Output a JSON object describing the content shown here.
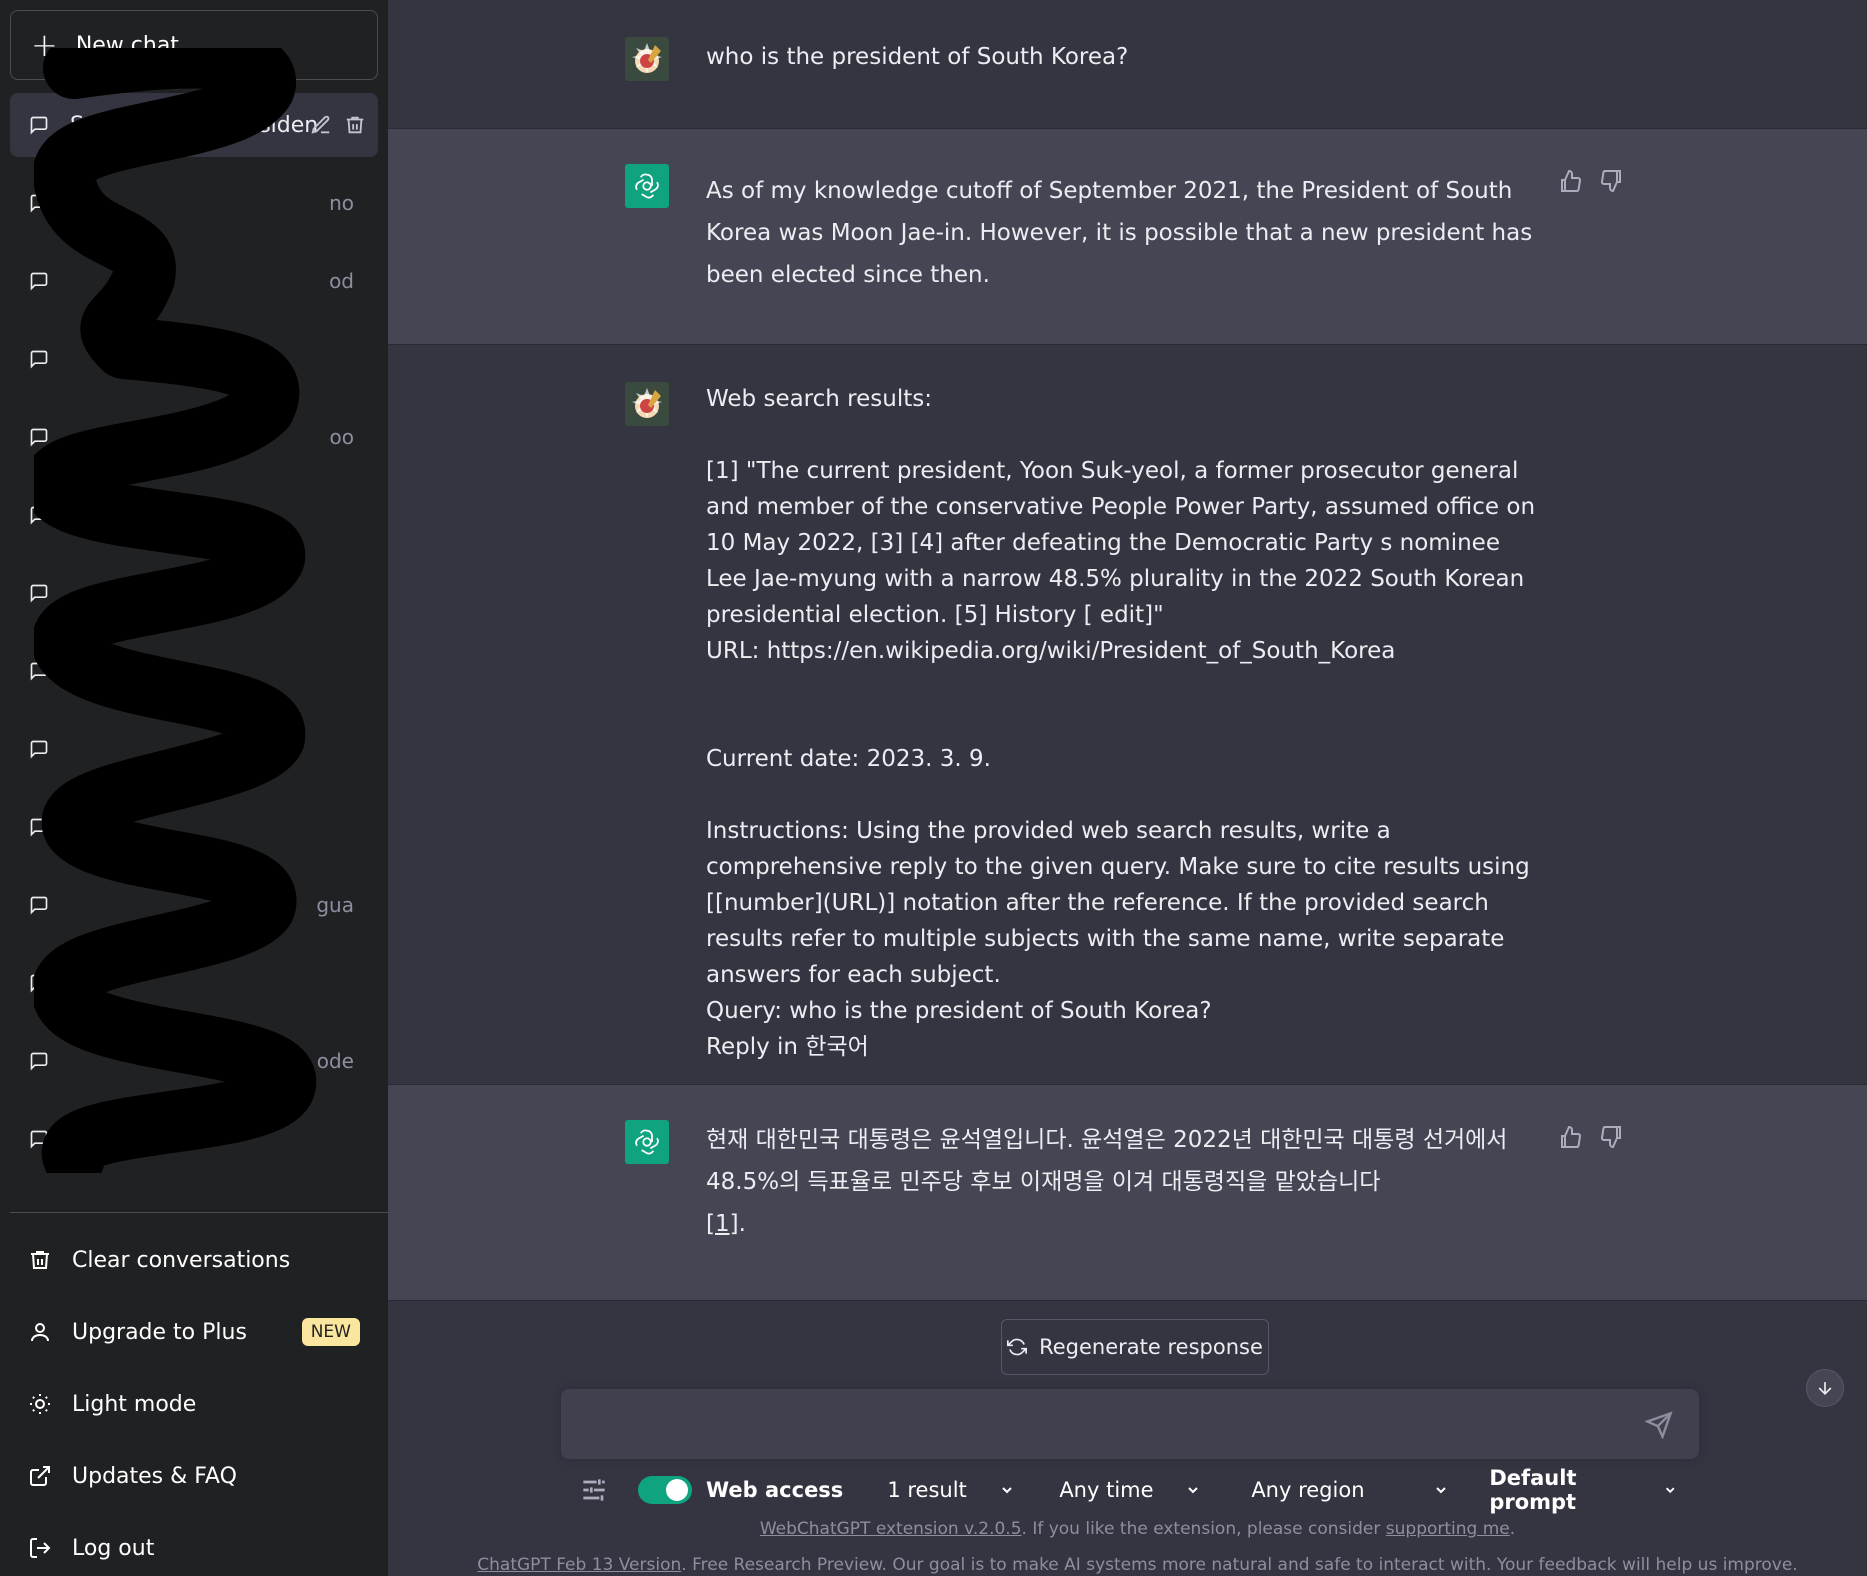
{
  "sidebar": {
    "new_chat": "New chat",
    "active_conversation": "South Korean Presiden",
    "conversations": [
      {
        "tail": "no"
      },
      {
        "tail": "od"
      },
      {
        "tail": ""
      },
      {
        "tail": "oo"
      },
      {
        "tail": ""
      },
      {
        "tail": ""
      },
      {
        "tail": ""
      },
      {
        "tail": ""
      },
      {
        "tail": ""
      },
      {
        "tail": "gua"
      },
      {
        "tail": ""
      },
      {
        "tail": "ode"
      },
      {
        "tail": ""
      }
    ],
    "bottom": {
      "clear": "Clear conversations",
      "upgrade": "Upgrade to Plus",
      "new_badge": "NEW",
      "light_mode": "Light mode",
      "updates": "Updates & FAQ",
      "logout": "Log out"
    }
  },
  "messages": {
    "user_1": "who is the president of South Korea?",
    "bot_1": "As of my knowledge cutoff of September 2021, the President of South Korea was Moon Jae-in. However, it is possible that a new president has been elected since then.",
    "user_2": "Web search results:\n\n[1] \"The current president, Yoon Suk-yeol, a former prosecutor general and member of the conservative People Power Party, assumed office on 10 May 2022, [3] [4] after defeating the Democratic Party s nominee Lee Jae-myung with a narrow 48.5% plurality in the 2022 South Korean presidential election. [5] History [ edit]\"\nURL: https://en.wikipedia.org/wiki/President_of_South_Korea\n\n\nCurrent date: 2023. 3. 9.\n\nInstructions: Using the provided web search results, write a comprehensive reply to the given query. Make sure to cite results using [[number](URL)] notation after the reference. If the provided search results refer to multiple subjects with the same name, write separate answers for each subject.\nQuery: who is the president of South Korea?\nReply in 한국어",
    "bot_2": "현재 대한민국 대통령은 윤석열입니다. 윤석열은 2022년 대한민국 대통령 선거에서 48.5%의 득표율로 민주당 후보 이재명을 이겨 대통령직을 맡았습니다",
    "bot_2_cite": "[1]",
    "bot_2_end": "."
  },
  "composer": {
    "regenerate": "Regenerate response",
    "web_access": "Web access",
    "results": "1 result",
    "time": "Any time",
    "region": "Any region",
    "prompt": "Default prompt"
  },
  "footer": {
    "ext_link": "WebChatGPT extension v.2.0.5",
    "ext_mid": ". If you like the extension, please consider ",
    "ext_support": "supporting me",
    "ext_end": ".",
    "version_link": "ChatGPT Feb 13 Version",
    "version_text": ". Free Research Preview. Our goal is to make AI systems more natural and safe to interact with. Your feedback will help us improve."
  },
  "colors": {
    "sidebar_bg": "#202123",
    "main_bg": "#343541",
    "bot_row_bg": "#444654",
    "accent": "#10a37f",
    "badge": "#fae69e"
  }
}
